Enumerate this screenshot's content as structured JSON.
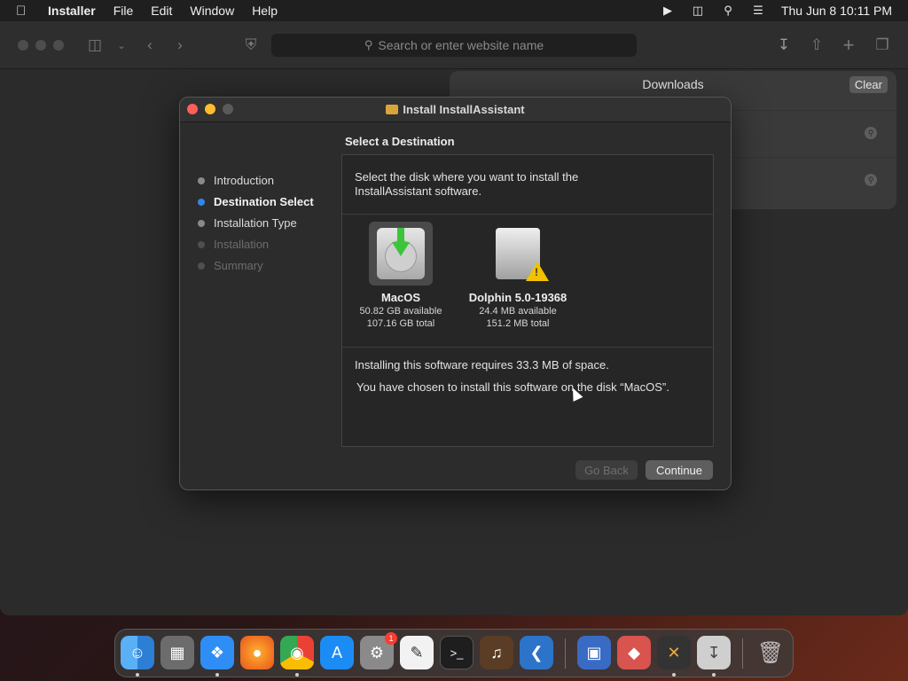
{
  "menubar": {
    "app_name": "Installer",
    "items": [
      "File",
      "Edit",
      "Window",
      "Help"
    ],
    "clock": "Thu Jun 8  10:11 PM"
  },
  "browser": {
    "search_placeholder": "Search or enter website name"
  },
  "downloads": {
    "title": "Downloads",
    "clear_label": "Clear"
  },
  "installer": {
    "title": "Install InstallAssistant",
    "section_heading": "Select a Destination",
    "steps": [
      {
        "label": "Introduction",
        "state": "done"
      },
      {
        "label": "Destination Select",
        "state": "active"
      },
      {
        "label": "Installation Type",
        "state": "pending"
      },
      {
        "label": "Installation",
        "state": "disabled"
      },
      {
        "label": "Summary",
        "state": "disabled"
      }
    ],
    "instruction": "Select the disk where you want to install the InstallAssistant software.",
    "disks": [
      {
        "name": "MacOS",
        "available": "50.82 GB available",
        "total": "107.16 GB total",
        "selected": true,
        "icon": "install-disk-icon"
      },
      {
        "name": "Dolphin 5.0-19368",
        "available": "24.4 MB available",
        "total": "151.2 MB total",
        "selected": false,
        "icon": "external-disk-warning-icon"
      }
    ],
    "requirement": "Installing this software requires 33.3 MB of space.",
    "chosen_text": "You have chosen to install this software on the disk “MacOS”.",
    "back_label": "Go Back",
    "continue_label": "Continue"
  },
  "dock": {
    "apps": [
      "finder-icon",
      "launchpad-icon",
      "safari-icon",
      "firefox-icon",
      "chrome-icon",
      "app-store-icon",
      "system-settings-icon",
      "textedit-icon",
      "terminal-icon",
      "garageband-icon",
      "vscode-icon",
      "remote-desktop-icon",
      "raspberry-imager-icon",
      "network-radar-icon",
      "installer-icon",
      "trash-icon"
    ],
    "settings_badge": "1"
  }
}
